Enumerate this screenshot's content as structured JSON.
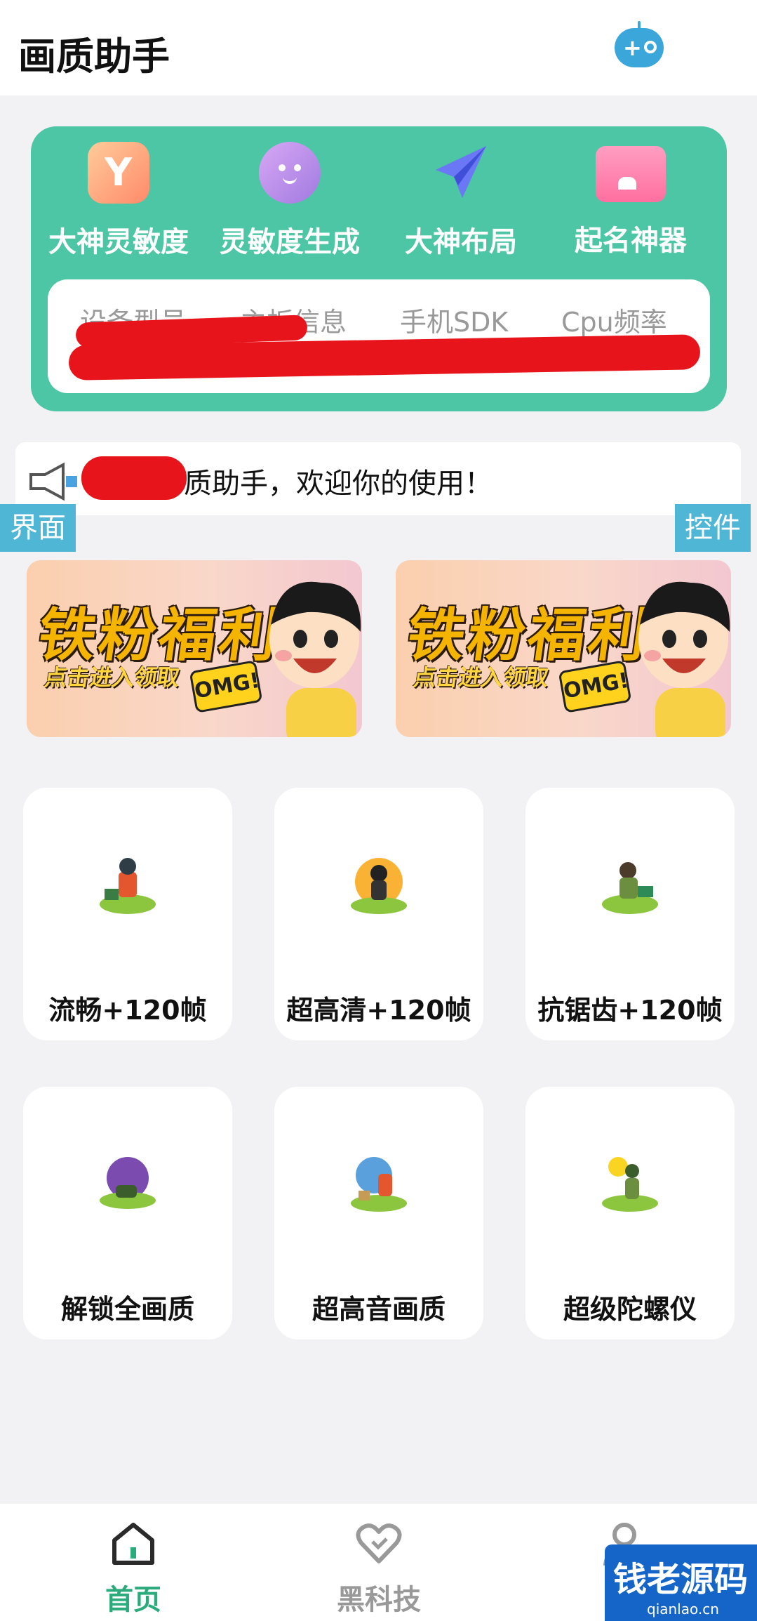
{
  "header": {
    "title": "画质助手"
  },
  "tools": [
    {
      "label": "大神灵敏度",
      "icon": "y-hexagon-icon"
    },
    {
      "label": "灵敏度生成",
      "icon": "smiley-face-icon"
    },
    {
      "label": "大神布局",
      "icon": "paper-plane-icon"
    },
    {
      "label": "起名神器",
      "icon": "card-icon"
    }
  ],
  "device_info": {
    "columns": [
      "设备型号",
      "主板信息",
      "手机SDK",
      "Cpu频率"
    ]
  },
  "notice": {
    "text": "质助手，欢迎你的使用！"
  },
  "tags": {
    "left": "界面",
    "right": "控件"
  },
  "banners": [
    {
      "title": "铁粉福利",
      "subtitle": "点击进入领取",
      "badge": "OMG!"
    },
    {
      "title": "铁粉福利",
      "subtitle": "点击进入领取",
      "badge": "OMG!"
    }
  ],
  "features": [
    {
      "label": "流畅+120帧"
    },
    {
      "label": "超高清+120帧"
    },
    {
      "label": "抗锯齿+120帧"
    },
    {
      "label": "解锁全画质"
    },
    {
      "label": "超高音画质"
    },
    {
      "label": "超级陀螺仪"
    }
  ],
  "nav": [
    {
      "label": "首页",
      "active": true
    },
    {
      "label": "黑科技",
      "active": false
    }
  ],
  "watermark": {
    "text": "钱老源码",
    "sub": "qianlao.cn"
  },
  "colors": {
    "accent": "#4cc6a4",
    "tag": "#4fb6d6",
    "nav_active": "#2bab7c",
    "nav_inactive": "#999999"
  }
}
